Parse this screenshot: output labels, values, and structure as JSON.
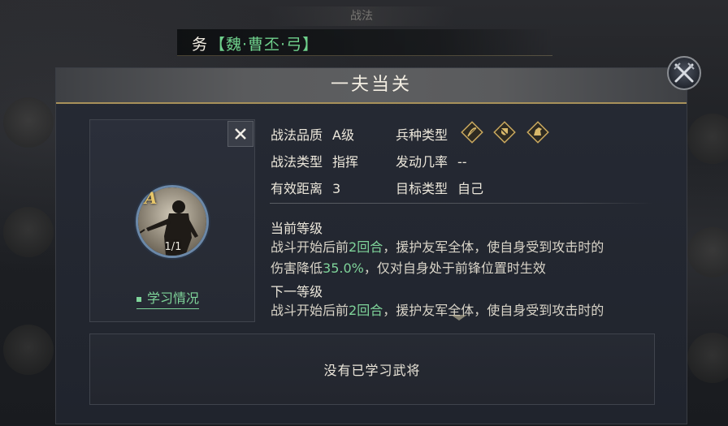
{
  "top_tab": {
    "label": "战法"
  },
  "general": {
    "prefix": "务",
    "name": "【魏·曹丕·弓】"
  },
  "panel": {
    "title": "一夫当关"
  },
  "skill_card": {
    "grade": "A",
    "level": "1/1",
    "learn_label": "学习情况"
  },
  "attributes": {
    "quality": {
      "label": "战法品质",
      "value": "A级"
    },
    "troop_type": {
      "label": "兵种类型",
      "icons": [
        "archer-troop-icon",
        "shield-troop-icon",
        "cavalry-troop-icon"
      ]
    },
    "skill_type": {
      "label": "战法类型",
      "value": "指挥"
    },
    "trigger_rate": {
      "label": "发动几率",
      "value": "--"
    },
    "range": {
      "label": "有效距离",
      "value": "3"
    },
    "target_type": {
      "label": "目标类型",
      "value": "自己"
    }
  },
  "current_level": {
    "heading": "当前等级",
    "line1_a": "战斗开始后前",
    "line1_hl": "2回合",
    "line1_b": "，援护友军全体，使自身受到攻击时的",
    "line2_a": "伤害降低",
    "line2_hl": "35.0%",
    "line2_b": "，仅对自身处于前锋位置时生效"
  },
  "next_level": {
    "heading": "下一等级",
    "line1_a": "战斗开始后前",
    "line1_hl": "2回合",
    "line1_b": "，援护友军全体，使自身受到攻击时的"
  },
  "generals_box": {
    "empty_text": "没有已学习武将"
  },
  "colors": {
    "highlight": "#7fd49a",
    "gold": "#a8915a",
    "accent_blue": "#6b88a8"
  }
}
